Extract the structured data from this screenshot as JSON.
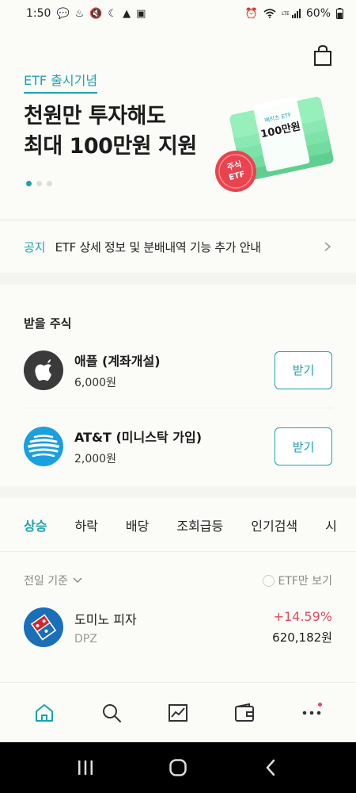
{
  "status_bar": {
    "time": "1:50",
    "battery": "60%"
  },
  "banner": {
    "tag": "ETF 출시기념",
    "title_line1": "천원만 투자해도",
    "title_line2": "최대 100만원 지원",
    "art_band_text": "100만원",
    "art_band_small": "메리츠 ETF",
    "art_badge_line1": "주식",
    "art_badge_line2": "ETF",
    "colors": {
      "accent": "#1aa3ad",
      "art_green": "#7ee3a8",
      "badge_red": "#e8444f"
    }
  },
  "notice": {
    "label": "공지",
    "text": "ETF 상세 정보 및 분배내역 기능 추가 안내"
  },
  "receive_stocks": {
    "title": "받을 주식",
    "items": [
      {
        "name": "애플 (계좌개설)",
        "amount": "6,000원",
        "button": "받기",
        "icon": "apple-icon"
      },
      {
        "name": "AT&T (미니스탁 가입)",
        "amount": "2,000원",
        "button": "받기",
        "icon": "att-icon"
      }
    ]
  },
  "ranking": {
    "tabs": [
      {
        "label": "상승",
        "active": true
      },
      {
        "label": "하락",
        "active": false
      },
      {
        "label": "배당",
        "active": false
      },
      {
        "label": "조회급등",
        "active": false
      },
      {
        "label": "인기검색",
        "active": false
      },
      {
        "label": "시",
        "active": false
      }
    ],
    "basis": "전일 기준",
    "etf_only": "ETF만 보기",
    "items": [
      {
        "name": "도미노 피자",
        "ticker": "DPZ",
        "change": "+14.59%",
        "price": "620,182원",
        "icon": "domino-icon"
      }
    ]
  },
  "bottom_nav": {
    "items": [
      "home-icon",
      "search-icon",
      "chart-icon",
      "wallet-icon",
      "more-icon"
    ]
  }
}
